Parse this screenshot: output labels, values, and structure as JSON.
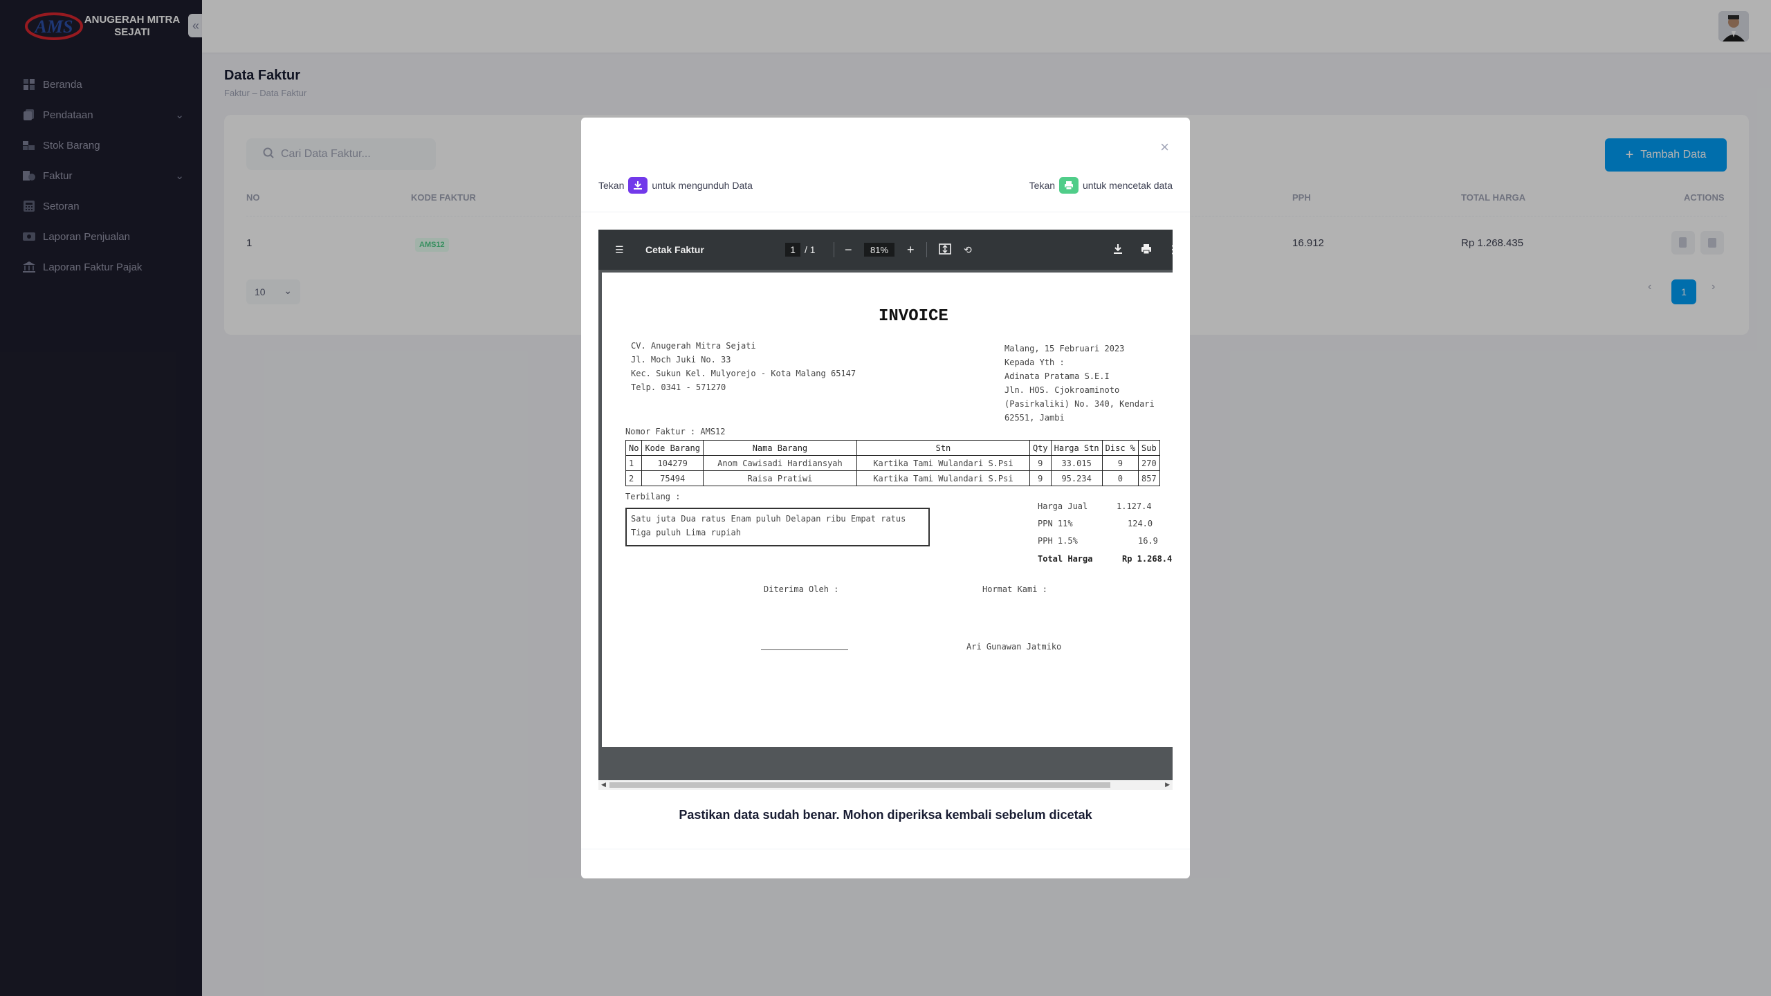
{
  "brand": {
    "name": "ANUGERAH MITRA SEJATI",
    "logo_text": "AMS"
  },
  "sidebar": {
    "items": [
      {
        "label": "Beranda"
      },
      {
        "label": "Pendataan"
      },
      {
        "label": "Stok Barang"
      },
      {
        "label": "Faktur"
      },
      {
        "label": "Setoran"
      },
      {
        "label": "Laporan Penjualan"
      },
      {
        "label": "Laporan Faktur Pajak"
      }
    ]
  },
  "page": {
    "title": "Data Faktur",
    "breadcrumb": "Faktur – Data Faktur"
  },
  "table": {
    "search_placeholder": "Cari Data Faktur...",
    "add_label": "Tambah Data",
    "headers": {
      "no": "NO",
      "kode": "KODE FAKTUR",
      "pph": "PPH",
      "total": "TOTAL HARGA",
      "actions": "ACTIONS"
    },
    "row": {
      "no": "1",
      "kode": "AMS12",
      "pph": "16.912",
      "total": "Rp 1.268.435"
    },
    "per_page": "10",
    "current_page": "1"
  },
  "modal": {
    "hint_download_prefix": "Tekan",
    "hint_download_suffix": "untuk mengunduh Data",
    "hint_print_prefix": "Tekan",
    "hint_print_suffix": "untuk mencetak data",
    "note": "Pastikan data sudah benar. Mohon diperiksa kembali sebelum dicetak"
  },
  "viewer": {
    "title": "Cetak Faktur",
    "page_current": "1",
    "page_total": "1",
    "zoom": "81%"
  },
  "invoice": {
    "heading": "INVOICE",
    "company": [
      "CV. Anugerah Mitra Sejati",
      "Jl. Moch Juki No. 33",
      "Kec. Sukun Kel. Mulyorejo - Kota Malang 65147",
      "Telp. 0341 - 571270"
    ],
    "date_line": "Malang, 15 Februari 2023",
    "to_label": "Kepada Yth :",
    "to": [
      "Adinata Pratama S.E.I",
      "Jln. HOS. Cjokroaminoto",
      "(Pasirkaliki) No. 340, Kendari",
      "62551, Jambi"
    ],
    "nomor": "Nomor Faktur : AMS12",
    "columns": [
      "No",
      "Kode Barang",
      "Nama Barang",
      "Stn",
      "Qty",
      "Harga Stn",
      "Disc %",
      "Sub"
    ],
    "rows": [
      [
        "1",
        "104279",
        "Anom Cawisadi Hardiansyah",
        "Kartika Tami Wulandari S.Psi",
        "9",
        "33.015",
        "9",
        "270"
      ],
      [
        "2",
        "75494",
        "Raisa Pratiwi",
        "Kartika Tami Wulandari S.Psi",
        "9",
        "95.234",
        "0",
        "857"
      ]
    ],
    "terbilang_label": "Terbilang :",
    "terbilang": "Satu juta Dua ratus Enam puluh Delapan ribu Empat ratus Tiga puluh Lima rupiah",
    "summary": [
      {
        "label": "Harga Jual",
        "value": "1.127.4"
      },
      {
        "label": "PPN 11%",
        "value": "124.0"
      },
      {
        "label": "PPH 1.5%",
        "value": "16.9"
      },
      {
        "label": "Total Harga",
        "value": "Rp 1.268.4"
      }
    ],
    "received": "Diterima Oleh :",
    "regards": "Hormat Kami :",
    "signer": "Ari Gunawan Jatmiko"
  },
  "colors": {
    "sidebar": "#1e1e2d",
    "primary": "#009ef7",
    "download_chip": "#7239ea",
    "print_chip": "#50cd89"
  }
}
